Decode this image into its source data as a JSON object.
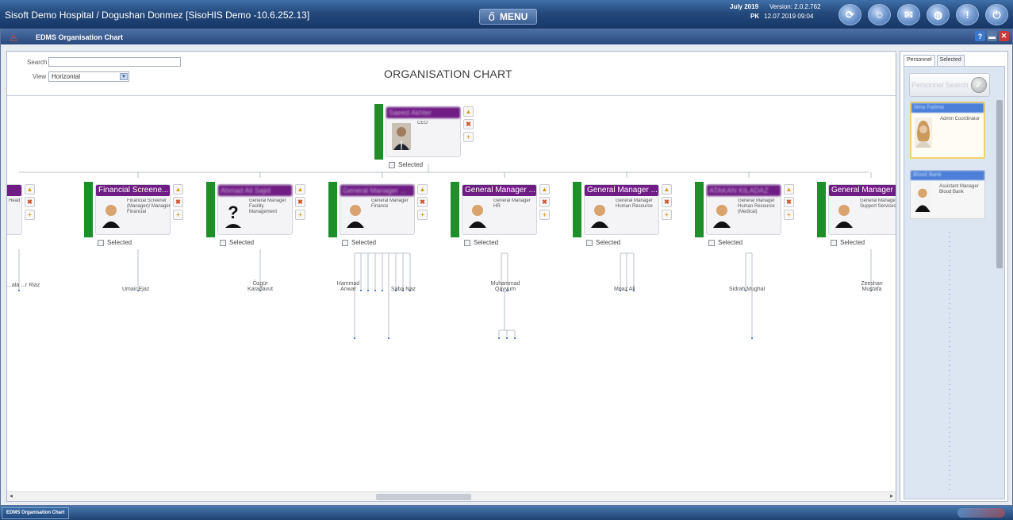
{
  "topbar": {
    "title": "Sisoft Demo Hospital / Dogushan Donmez [SisoHIS Demo -10.6.252.13]",
    "menu_label": "MENU",
    "date_label": "July 2019",
    "version": "Version: 2.0.2.762",
    "locale": "PK",
    "datetime": "12.07.2019  09:04"
  },
  "window": {
    "title": "EDMS Organisation Chart"
  },
  "toolbar": {
    "search_label": "Search",
    "search_value": "",
    "view_label": "View",
    "view_value": "Horizontal",
    "chart_title": "ORGANISATION CHART"
  },
  "root": {
    "name": "Saeed Akhter",
    "role": "CEO",
    "selected_label": "Selected"
  },
  "nodes": [
    {
      "name": "...tholog...",
      "role": "...tor ...ology / Head",
      "selected_label": "Selected",
      "blur": false
    },
    {
      "name": "Financial Screene...",
      "role": "Financial Screener (Manager)/ Manager Financial",
      "selected_label": "Selected",
      "blur": false
    },
    {
      "name": "Ahmad Ali Sajid",
      "role": "General Manager Facility Management",
      "selected_label": "Selected",
      "blur": true
    },
    {
      "name": "General Manager ...",
      "role": "General Manager Finance",
      "selected_label": "Selected",
      "blur": true
    },
    {
      "name": "General Manager ...",
      "role": "General Manager HR",
      "selected_label": "Selected",
      "blur": false
    },
    {
      "name": "General Manager ...",
      "role": "General Manager Human Resource",
      "selected_label": "Selected",
      "blur": false
    },
    {
      "name": "ATAKAN KILADAZ",
      "role": "General Manager Human Resource (Medical)",
      "selected_label": "Selected",
      "blur": true
    },
    {
      "name": "General Manager ...",
      "role": "General Manager Support Services",
      "selected_label": "Selected",
      "blur": false
    }
  ],
  "sub_names": [
    {
      "text": "...ala ...r Riaz"
    },
    {
      "text": "Umair Ejaz"
    },
    {
      "text": "Özgür Karadavut"
    },
    {
      "text": "Hammad Anwar"
    },
    {
      "text": "Saba Naz"
    },
    {
      "text": "Muhammad Qayyum"
    },
    {
      "text": "Moaz Ali"
    },
    {
      "text": "Sidrah Mughal"
    },
    {
      "text": "Zeeshan Mustafa"
    }
  ],
  "panel": {
    "tabs": [
      "Personnel",
      "Selected"
    ],
    "search_placeholder": "Personnel Search",
    "cards": [
      {
        "name": "Nina Fatima",
        "role": "Admin Coordinator"
      },
      {
        "name": "Blood Bank",
        "role": "Assistant Manager Blood Bank"
      }
    ]
  },
  "taskbar": {
    "item": "EDMS Organisation Chart"
  }
}
